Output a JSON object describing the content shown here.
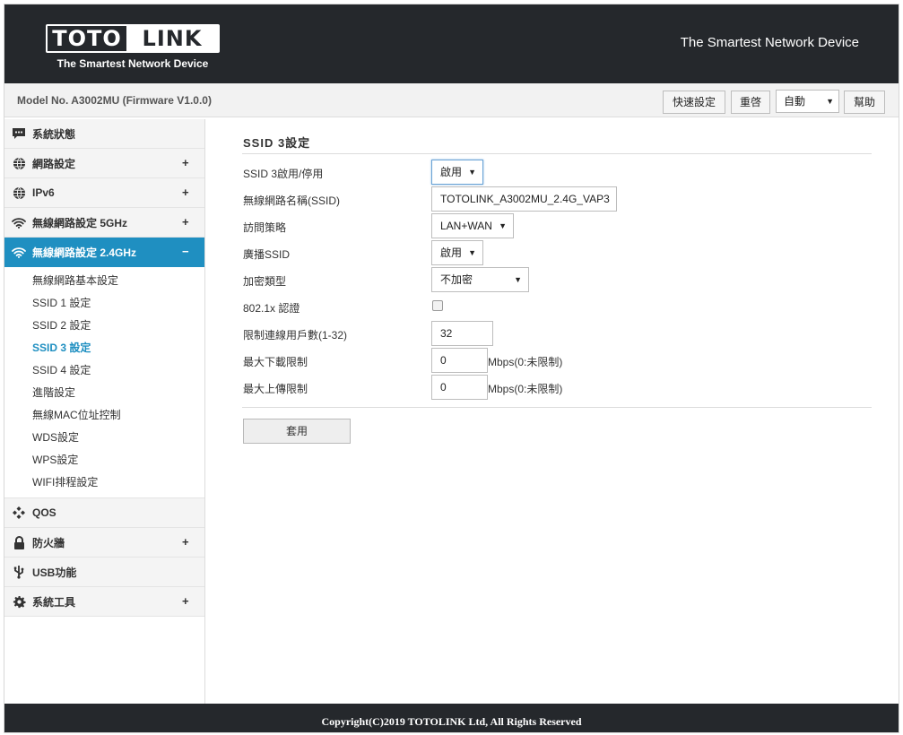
{
  "header": {
    "logo_left": "TOTO",
    "logo_right": "LINK",
    "logo_tagline": "The Smartest Network Device",
    "slogan": "The Smartest Network Device"
  },
  "toolbar": {
    "model": "Model No. A3002MU (Firmware V1.0.0)",
    "quick_setup": "快速設定",
    "reboot": "重啓",
    "language": "自動",
    "help": "幫助"
  },
  "sidebar": {
    "items": [
      {
        "label": "系統狀態",
        "icon": "chat-icon",
        "expand": ""
      },
      {
        "label": "網路設定",
        "icon": "globe-icon",
        "expand": "+"
      },
      {
        "label": "IPv6",
        "icon": "globe-icon",
        "expand": "+"
      },
      {
        "label": "無線網路設定 5GHz",
        "icon": "wifi-icon",
        "expand": "+"
      },
      {
        "label": "無線網路設定 2.4GHz",
        "icon": "wifi-icon",
        "expand": "−"
      },
      {
        "label": "QOS",
        "icon": "qos-icon",
        "expand": ""
      },
      {
        "label": "防火牆",
        "icon": "lock-icon",
        "expand": "+"
      },
      {
        "label": "USB功能",
        "icon": "usb-icon",
        "expand": ""
      },
      {
        "label": "系統工具",
        "icon": "gear-icon",
        "expand": "+"
      }
    ],
    "sub_items": [
      "無線網路基本設定",
      "SSID 1 設定",
      "SSID 2 設定",
      "SSID 3 設定",
      "SSID 4 設定",
      "進階設定",
      "無線MAC位址控制",
      "WDS設定",
      "WPS設定",
      "WIFI排程設定"
    ],
    "active_sub_index": 3
  },
  "main": {
    "title": "SSID 3設定",
    "labels": {
      "enable": "SSID 3啟用/停用",
      "ssid": "無線網路名稱(SSID)",
      "access": "訪問策略",
      "broadcast": "廣播SSID",
      "encryption": "加密類型",
      "dot1x": "802.1x 認證",
      "max_clients": "限制連線用戶數(1-32)",
      "max_download": "最大下載限制",
      "max_upload": "最大上傳限制"
    },
    "values": {
      "enable": "啟用",
      "ssid": "TOTOLINK_A3002MU_2.4G_VAP3",
      "access": "LAN+WAN",
      "broadcast": "啟用",
      "encryption": "不加密",
      "max_clients": "32",
      "max_download": "0",
      "max_upload": "0"
    },
    "dot1x_checked": false,
    "unit_download": "Mbps(0:未限制)",
    "unit_upload": "Mbps(0:未限制)",
    "apply": "套用"
  },
  "footer": {
    "copyright": "Copyright(C)2019 TOTOLINK Ltd, All Rights Reserved"
  },
  "colors": {
    "header_bg": "#25282c",
    "accent": "#1f8fc1"
  }
}
